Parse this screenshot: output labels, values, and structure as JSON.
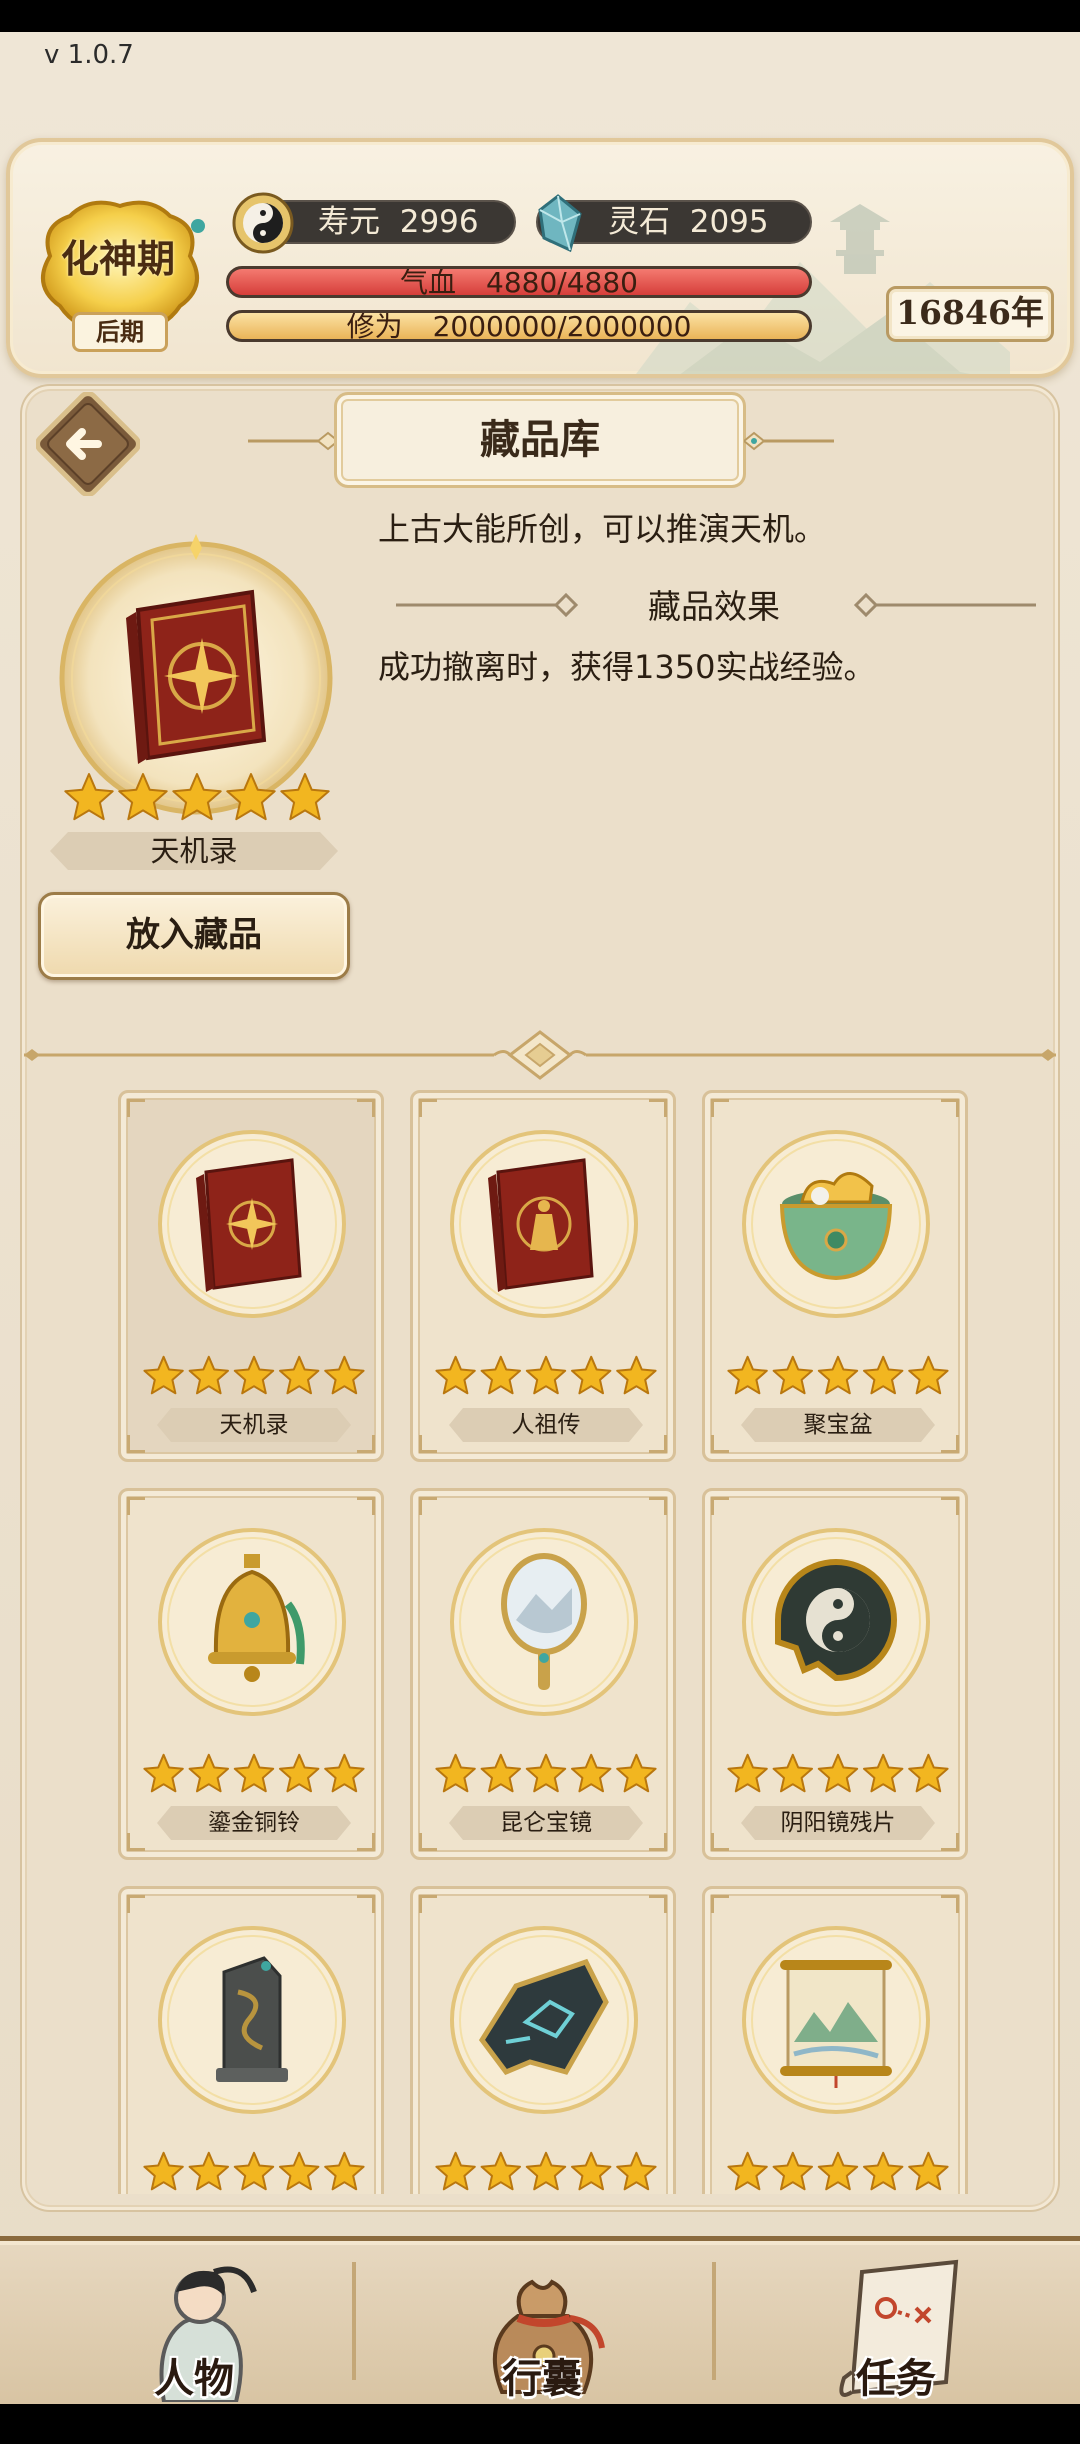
{
  "app": {
    "version": "v 1.0.7"
  },
  "colors": {
    "hp": "#e8534f",
    "cultivation": "#f0c36a",
    "gold": "#f2b620",
    "panel": "#ebdfca"
  },
  "header": {
    "realm": "化神期",
    "stage": "后期",
    "lifespan_label": "寿元",
    "lifespan_value": "2996",
    "spirit_stone_label": "灵石",
    "spirit_stone_value": "2095",
    "hp_label": "气血",
    "hp_value": "4880/4880",
    "hp_fraction": 1.0,
    "cultivation_label": "修为",
    "cultivation_value": "2000000/2000000",
    "cultivation_fraction": 1.0,
    "years": "16846年"
  },
  "panel": {
    "title": "藏品库",
    "selected": {
      "name": "天机录",
      "stars": 5,
      "icon": "red-book-compass-icon",
      "description": "上古大能所创，可以推演天机。",
      "effect_title": "藏品效果",
      "effect_text": "成功撤离时，获得1350实战经验。",
      "action_label": "放入藏品"
    },
    "items": [
      {
        "name": "天机录",
        "stars": 5,
        "icon": "red-book-compass-icon",
        "selected": true
      },
      {
        "name": "人祖传",
        "stars": 5,
        "icon": "red-book-figure-icon",
        "selected": false
      },
      {
        "name": "聚宝盆",
        "stars": 5,
        "icon": "treasure-bowl-icon",
        "selected": false
      },
      {
        "name": "鎏金铜铃",
        "stars": 5,
        "icon": "golden-bell-icon",
        "selected": false
      },
      {
        "name": "昆仑宝镜",
        "stars": 5,
        "icon": "hand-mirror-icon",
        "selected": false
      },
      {
        "name": "阴阳镜残片",
        "stars": 5,
        "icon": "yin-yang-shard-icon",
        "selected": false
      },
      {
        "name": "",
        "stars": 5,
        "icon": "dragon-stele-icon",
        "selected": false
      },
      {
        "name": "",
        "stars": 5,
        "icon": "jade-blade-shard-icon",
        "selected": false
      },
      {
        "name": "",
        "stars": 5,
        "icon": "landscape-scroll-icon",
        "selected": false
      }
    ]
  },
  "nav": [
    {
      "label": "人物",
      "icon": "character-icon"
    },
    {
      "label": "行囊",
      "icon": "bag-icon"
    },
    {
      "label": "任务",
      "icon": "quest-scroll-icon"
    }
  ]
}
